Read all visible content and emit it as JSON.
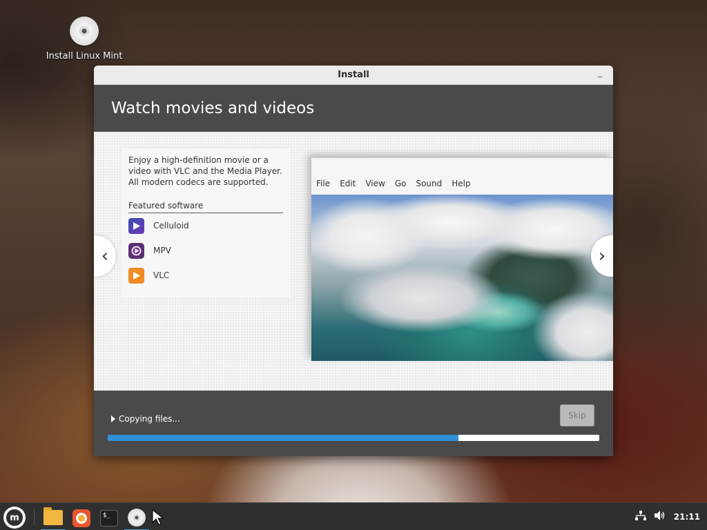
{
  "desktop": {
    "icon_label": "Install Linux Mint"
  },
  "window": {
    "title": "Install",
    "minimize_glyph": "_",
    "heading": "Watch movies and videos"
  },
  "slide": {
    "description": "Enjoy a high-definition movie or a video with VLC and the Media Player. All modern codecs are supported.",
    "featured_title": "Featured software",
    "software": [
      {
        "name": "Celluloid",
        "icon": "celluloid-icon"
      },
      {
        "name": "MPV",
        "icon": "mpv-icon"
      },
      {
        "name": "VLC",
        "icon": "vlc-icon"
      }
    ],
    "nav_prev": "‹",
    "nav_next": "›",
    "screenshot_menu": [
      "File",
      "Edit",
      "View",
      "Go",
      "Sound",
      "Help"
    ]
  },
  "footer": {
    "status": "Copying files...",
    "skip_label": "Skip",
    "progress_fraction": 0.714,
    "progress_color": "#2f8fd8"
  },
  "taskbar": {
    "apps": [
      "files-icon",
      "firefox-icon",
      "terminal-icon",
      "installer-disc-icon"
    ],
    "terminal_glyph": "$_",
    "clock": "21:11"
  }
}
